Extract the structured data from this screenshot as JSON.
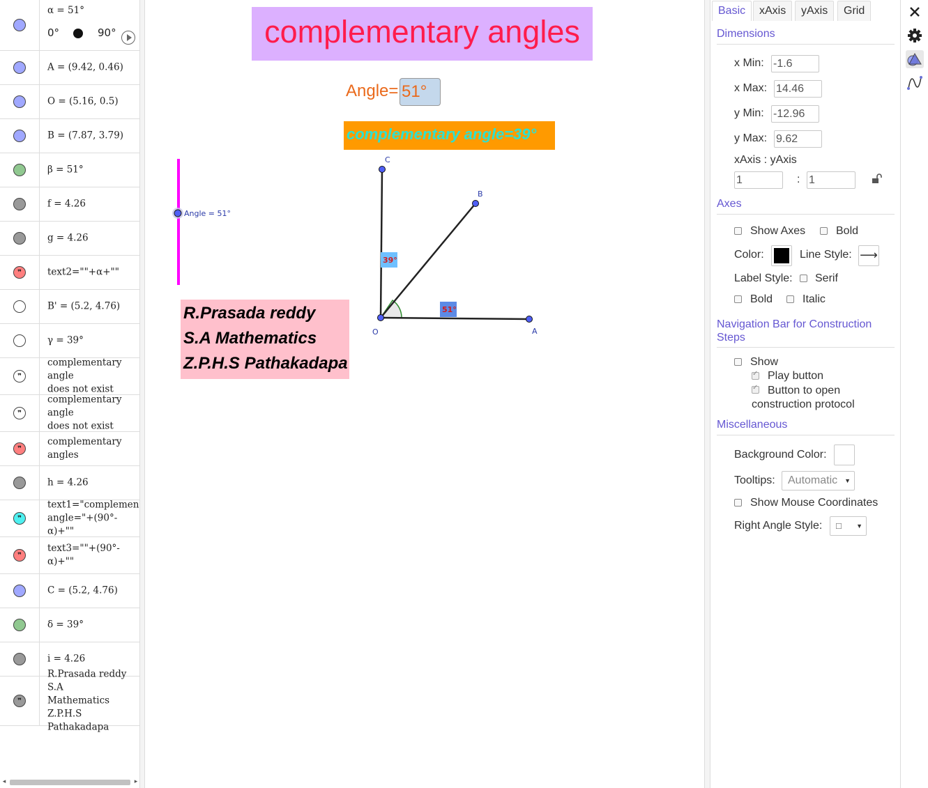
{
  "algebra": {
    "slider": {
      "text": "α = 51°",
      "min": "0°",
      "max": "90°",
      "color": "#a0a8ff"
    },
    "rows": [
      {
        "text": "A = (9.42, 0.46)",
        "marble": "#a0a8ff",
        "type": "point"
      },
      {
        "text": "O = (5.16, 0.5)",
        "marble": "#a0a8ff",
        "type": "point"
      },
      {
        "text": "B = (7.87, 3.79)",
        "marble": "#a0a8ff",
        "type": "point"
      },
      {
        "text": "β = 51°",
        "marble": "#90c890",
        "type": "angle"
      },
      {
        "text": "f = 4.26",
        "marble": "#999999",
        "type": "segment"
      },
      {
        "text": "g = 4.26",
        "marble": "#999999",
        "type": "segment"
      },
      {
        "text": "text2=\"\"+α+\"\"",
        "marble": "#ff7f7f",
        "type": "quote"
      },
      {
        "text": "B' = (5.2, 4.76)",
        "marble": "#ffffff",
        "type": "point"
      },
      {
        "text": "γ = 39°",
        "marble": "#ffffff",
        "type": "angle"
      },
      {
        "text": "complementary angle\ndoes not exist",
        "marble": "#ffffff",
        "type": "quote"
      },
      {
        "text": "complementary angle\ndoes not exist",
        "marble": "#ffffff",
        "type": "quote"
      },
      {
        "text": "complementary angles",
        "marble": "#ff7f7f",
        "type": "quote"
      },
      {
        "text": "h = 4.26",
        "marble": "#999999",
        "type": "segment"
      },
      {
        "text": "text1=\"complementary\nangle=\"+(90°-α)+\"\"",
        "marble": "#4ef0f0",
        "type": "quote"
      },
      {
        "text": "text3=\"\"+(90°-\nα)+\"\"",
        "marble": "#ff7f7f",
        "type": "quote"
      },
      {
        "text": "C = (5.2, 4.76)",
        "marble": "#a0a8ff",
        "type": "point"
      },
      {
        "text": "δ = 39°",
        "marble": "#90c890",
        "type": "angle"
      },
      {
        "text": "i = 4.26",
        "marble": "#999999",
        "type": "segment"
      },
      {
        "text": "R.Prasada reddy S.A\nMathematics Z.P.H.S\nPathakadapa",
        "marble": "#999999",
        "type": "quote"
      }
    ]
  },
  "graphics": {
    "title": "complementary angles",
    "angle_label": "Angle=",
    "angle_value": "51°",
    "comp_text": "complementary angle=39°",
    "author_lines": [
      "R.Prasada reddy",
      "S.A Mathematics",
      "Z.P.H.S Pathakadapa"
    ],
    "slider_label": "Angle = 51°",
    "points": {
      "C": "C",
      "B": "B",
      "O": "O",
      "A": "A"
    },
    "angle_labels": {
      "gamma": "39°",
      "beta": "51°"
    },
    "colors": {
      "slider": "#ff00ff",
      "point": "#4f5ff5",
      "angle_arc": "#2e8b2e",
      "angle_label_bg": "#6fa8dc",
      "angle_label_bg_b": "#5c8ae6"
    }
  },
  "properties": {
    "tabs": [
      "Basic",
      "xAxis",
      "yAxis",
      "Grid"
    ],
    "active_tab": "Basic",
    "dimensions": {
      "title": "Dimensions",
      "xmin_label": "x Min:",
      "xmin": "-1.6",
      "xmax_label": "x Max:",
      "xmax": "14.46",
      "ymin_label": "y Min:",
      "ymin": "-12.96",
      "ymax_label": "y Max:",
      "ymax": "9.62",
      "ratio_label": "xAxis : yAxis",
      "ratio_x": "1",
      "ratio_sep": ":",
      "ratio_y": "1"
    },
    "axes": {
      "title": "Axes",
      "show_axes": "Show Axes",
      "bold": "Bold",
      "color_label": "Color:",
      "color": "#000000",
      "line_style_label": "Line Style:",
      "line_style": "⟶",
      "label_style_label": "Label Style:",
      "serif": "Serif",
      "bold2": "Bold",
      "italic": "Italic"
    },
    "navbar": {
      "title": "Navigation Bar for Construction Steps",
      "show": "Show",
      "play_button": "Play button",
      "open_protocol": "Button to open construction protocol"
    },
    "misc": {
      "title": "Miscellaneous",
      "bg_color_label": "Background Color:",
      "bg_color": "#ffffff",
      "tooltips_label": "Tooltips:",
      "tooltips": "Automatic",
      "show_mouse": "Show Mouse Coordinates",
      "right_angle_label": "Right Angle Style:",
      "right_angle": "□"
    }
  },
  "side_tools": [
    "close-icon",
    "gear-icon",
    "graphics-style-icon",
    "function-curve-icon"
  ]
}
